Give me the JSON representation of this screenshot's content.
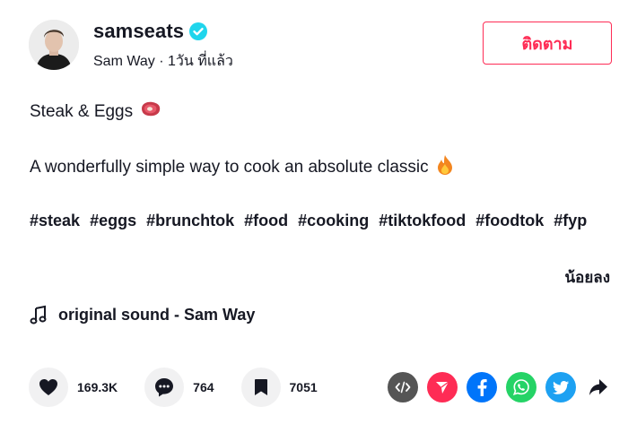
{
  "header": {
    "username": "samseats",
    "display_name": "Sam Way",
    "separator": " · ",
    "time_ago": "1วัน ที่แล้ว",
    "follow_label": "ติดตาม"
  },
  "post": {
    "title": "Steak & Eggs",
    "description": "A wonderfully simple way to cook an absolute classic",
    "hashtags": [
      "#steak",
      "#eggs",
      "#brunchtok",
      "#food",
      "#cooking",
      "#tiktokfood",
      "#foodtok",
      "#fyp"
    ],
    "less_label": "น้อยลง",
    "music": "original sound - Sam Way"
  },
  "stats": {
    "likes": "169.3K",
    "comments": "764",
    "saves": "7051"
  },
  "icons": {
    "verified": "verified-badge-icon",
    "title_emoji": "steak-emoji-icon",
    "desc_emoji": "fire-emoji-icon",
    "music": "music-note-icon",
    "like": "heart-icon",
    "comment": "comment-icon",
    "save": "bookmark-icon",
    "embed": "code-icon",
    "send": "send-icon",
    "facebook": "facebook-icon",
    "whatsapp": "whatsapp-icon",
    "twitter": "twitter-icon",
    "share": "share-arrow-icon"
  },
  "colors": {
    "accent": "#fe2c55",
    "verified": "#20d5ec",
    "embed": "#555555",
    "send": "#fe2c55",
    "facebook": "#0075fa",
    "whatsapp": "#25d366",
    "twitter": "#1da1f2"
  }
}
